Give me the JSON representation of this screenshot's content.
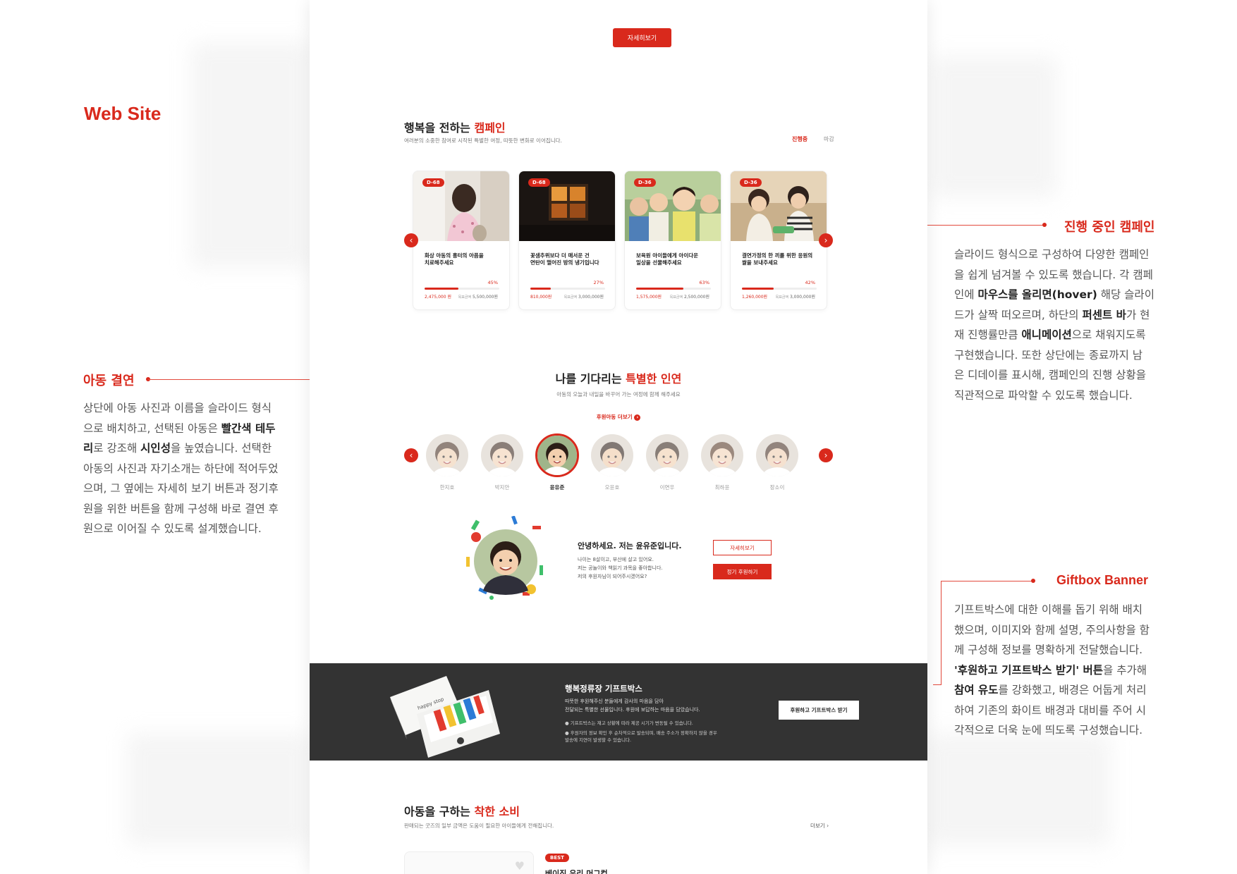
{
  "annotations": {
    "site_title": "Web Site",
    "left": {
      "title": "아동 결연",
      "body_lines": [
        "상단에 아동 사진과 이름을 슬라이드 형식",
        "으로 배치하고, 선택된 아동은 <b>빨간색 테두</b>",
        "<b>리</b>로 강조해 <b>시인성</b>을 높였습니다. 선택한",
        "아동의 사진과 자기소개는 하단에 적어두었",
        "으며, 그 옆에는 자세히 보기 버튼과 정기후",
        "원을 위한 버튼을 함께 구성해 바로 결연 후",
        "원으로 이어질 수 있도록 설계했습니다."
      ]
    },
    "right_campaign": {
      "title": "진행 중인 캠페인",
      "body_lines": [
        "슬라이드 형식으로 구성하여 다양한 캠페인",
        "을 쉽게 넘겨볼 수 있도록 했습니다. 각 캠페",
        "인에 <b>마우스를 올리면(hover)</b> 해당 슬라이",
        "드가 살짝 떠오르며, 하단의 <b>퍼센트 바</b>가 현",
        "재 진행률만큼 <b>애니메이션</b>으로 채워지도록",
        "구현했습니다. 또한 상단에는 종료까지 남",
        "은 디데이를 표시해, 캠페인의 진행 상황을",
        "직관적으로 파악할 수 있도록 했습니다."
      ]
    },
    "right_gift": {
      "title": "Giftbox Banner",
      "body_lines": [
        "기프트박스에 대한 이해를 돕기 위해 배치",
        "했으며, 이미지와 함께 설명, 주의사항을 함",
        "께 구성해 정보를 명확하게 전달했습니다.",
        "<b>'후원하고 기프트박스 받기' 버튼</b>을 추가해",
        "<b>참여 유도</b>를 강화했고, 배경은 어둡게 처리",
        "하여 기존의 화이트 배경과 대비를 주어 시",
        "각적으로 더욱 눈에 띄도록 구성했습니다."
      ]
    }
  },
  "page": {
    "top_button": "자세히보기",
    "campaign": {
      "title_plain": "행복을 전하는 ",
      "title_accent": "캠페인",
      "subtitle": "여러분의 소중한 참여로 시작된 특별한 여정, 따뜻한 변화로 이어집니다.",
      "tab_active": "진행중",
      "tab_inactive": "마감",
      "goal_label": "목표금액",
      "cards": [
        {
          "dday": "D-68",
          "title": "화상 아동의 흉터의 아픔을\n치료해주세요",
          "percent": 45,
          "percent_label": "45%",
          "raised": "2,475,000 원",
          "goal": "5,500,000원"
        },
        {
          "dday": "D-68",
          "title": "꽃샘추위보다 더 매서운 건\n연탄이 떨어진 방의 냉기입니다",
          "percent": 27,
          "percent_label": "27%",
          "raised": "810,000원",
          "goal": "3,000,000원"
        },
        {
          "dday": "D-36",
          "title": "보육원 아이들에게 아이다운\n일상을 선물해주세요",
          "percent": 63,
          "percent_label": "63%",
          "raised": "1,575,000원",
          "goal": "2,500,000원"
        },
        {
          "dday": "D-36",
          "title": "결연가정의 한 끼를 위한 응원의\n쌀을 보내주세요",
          "percent": 42,
          "percent_label": "42%",
          "raised": "1,260,000원",
          "goal": "3,000,000원"
        }
      ]
    },
    "sponsor": {
      "title_plain": "나를 기다리는 ",
      "title_accent": "특별한 인연",
      "subtitle": "아동의 오늘과 내일을 바꾸어 가는 여정에 함께 해주세요",
      "more_link": "후원아동 더보기",
      "children": [
        "한지호",
        "박지안",
        "윤유준",
        "오윤호",
        "이연우",
        "최하윤",
        "장소이"
      ],
      "selected_index": 2,
      "intro_title": "안녕하세요. 저는 윤유준입니다.",
      "intro_lines": [
        "나이는 8살이고, 부산에 살고 있어요.",
        "저는 공놀이와 책읽기 과목을 좋아합니다.",
        "저의 후원자님이 되어주시겠어요?"
      ],
      "detail_button": "자세히보기",
      "regular_button": "정기 후원하기"
    },
    "giftbox": {
      "title": "행복정류장 기프트박스",
      "desc_lines": [
        "따뜻한 후원해주신 분들에게 감사의 마음을 담아",
        "전달되는 특별한 선물입니다. 후원에 보답하는 마음을 담았습니다."
      ],
      "notes": [
        "기프트박스는 재고 상황에 따라 제공 시기가 변동될 수 있습니다.",
        "후원자의 정보 확인 후 순차적으로 발송되며, 배송 주소가 정확하지 않을 경우\n발송에 지연이 발생할 수 있습니다."
      ],
      "button": "후원하고 기프트박스 받기"
    },
    "shop": {
      "title_plain": "아동을 구하는 ",
      "title_accent": "착한 소비",
      "subtitle": "판매되는 굿즈의 일부 금액은 도움이 필요한 아이들에게 전해집니다.",
      "more": "더보기",
      "badge": "BEST",
      "item_title": "베이직 우리 머그컵"
    }
  }
}
